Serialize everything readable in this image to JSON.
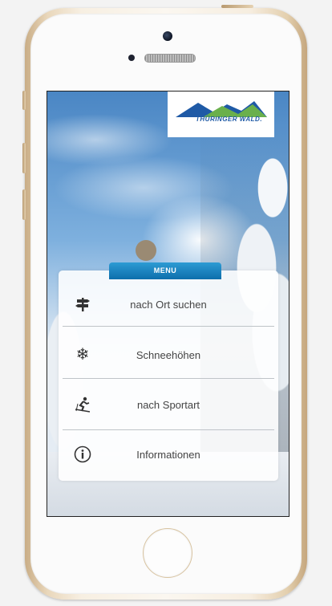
{
  "app": {
    "logo_text": "THÜRINGER WALD.",
    "menu_title": "MENU"
  },
  "menu": {
    "items": [
      {
        "label": "nach Ort suchen",
        "icon": "signpost-icon"
      },
      {
        "label": "Schneehöhen",
        "icon": "snowflake-icon"
      },
      {
        "label": "nach Sportart",
        "icon": "skier-icon"
      },
      {
        "label": "Informationen",
        "icon": "info-icon"
      }
    ]
  },
  "colors": {
    "menu_tab": "#1a82c2",
    "logo_blue": "#1f5aa6",
    "logo_green": "#6ab04c"
  }
}
